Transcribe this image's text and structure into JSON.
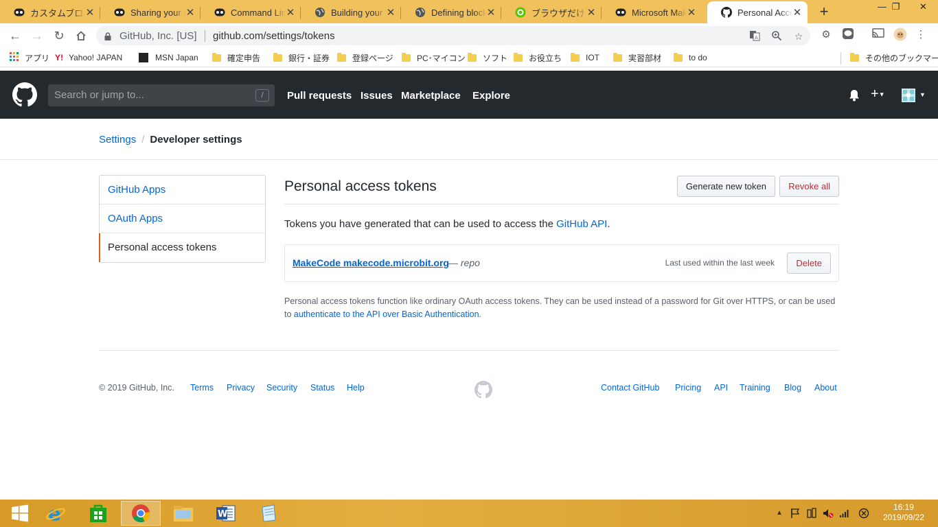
{
  "browser": {
    "tabs": [
      {
        "title": "カスタムブロック - ",
        "icon": "makecode-icon"
      },
      {
        "title": "Sharing your p",
        "icon": "makecode-icon"
      },
      {
        "title": "Command Line",
        "icon": "makecode-icon"
      },
      {
        "title": "Building your",
        "icon": "globe-icon"
      },
      {
        "title": "Defining block",
        "icon": "globe-icon"
      },
      {
        "title": "ブラウザだけで m",
        "icon": "qiita-icon"
      },
      {
        "title": "Microsoft Mak",
        "icon": "makecode-icon"
      },
      {
        "title": "Personal Acce",
        "icon": "github-icon",
        "active": true
      }
    ],
    "address": {
      "site_label": "GitHub, Inc. [US]",
      "url": "github.com/settings/tokens"
    },
    "bookmarks": [
      {
        "label": "アプリ",
        "icon": "apps-grid-icon"
      },
      {
        "label": "Yahoo! JAPAN",
        "icon": "yahoo-icon"
      },
      {
        "label": "MSN Japan",
        "icon": "msn-icon"
      },
      {
        "label": "確定申告",
        "icon": "folder-icon"
      },
      {
        "label": "銀行・証券",
        "icon": "folder-icon"
      },
      {
        "label": "登録ページ",
        "icon": "folder-icon"
      },
      {
        "label": "PC･マイコン",
        "icon": "folder-icon"
      },
      {
        "label": "ソフト",
        "icon": "folder-icon"
      },
      {
        "label": "お役立ち",
        "icon": "folder-icon"
      },
      {
        "label": "IOT",
        "icon": "folder-icon"
      },
      {
        "label": "実習部材",
        "icon": "folder-icon"
      },
      {
        "label": "to do",
        "icon": "folder-icon"
      },
      {
        "label": "その他のブックマーク",
        "icon": "folder-icon"
      }
    ]
  },
  "github": {
    "search_placeholder": "Search or jump to...",
    "search_shortcut": "/",
    "nav": [
      "Pull requests",
      "Issues",
      "Marketplace",
      "Explore"
    ],
    "breadcrumb": {
      "parent": "Settings",
      "current": "Developer settings"
    },
    "sidebar": [
      {
        "label": "GitHub Apps"
      },
      {
        "label": "OAuth Apps"
      },
      {
        "label": "Personal access tokens",
        "selected": true
      }
    ],
    "main": {
      "title": "Personal access tokens",
      "generate_label": "Generate new token",
      "revoke_label": "Revoke all",
      "intro_text": "Tokens you have generated that can be used to access the ",
      "intro_link": "GitHub API",
      "intro_end": ".",
      "token": {
        "name": "MakeCode makecode.microbit.org",
        "scope": "— repo",
        "last_used": "Last used within the last week",
        "delete_label": "Delete"
      },
      "note_text": "Personal access tokens function like ordinary OAuth access tokens. They can be used instead of a password for Git over HTTPS, or can be used to ",
      "note_link": "authenticate to the API over Basic Authentication",
      "note_end": "."
    },
    "footer": {
      "copyright": "© 2019 GitHub, Inc.",
      "left_links": [
        "Terms",
        "Privacy",
        "Security",
        "Status",
        "Help"
      ],
      "right_links": [
        "Contact GitHub",
        "Pricing",
        "API",
        "Training",
        "Blog",
        "About"
      ]
    }
  },
  "taskbar": {
    "apps": [
      "windows-start-icon",
      "internet-explorer-icon",
      "windows-store-icon",
      "chrome-icon",
      "file-explorer-icon",
      "word-icon",
      "notepad-icon"
    ],
    "time": "16:19",
    "date": "2019/09/22"
  },
  "colors": {
    "accent_link": "#0366d6",
    "github_header": "#24292e",
    "selected_marker": "#e36209",
    "danger": "#cb2431",
    "taskbar": "#d79a26"
  }
}
